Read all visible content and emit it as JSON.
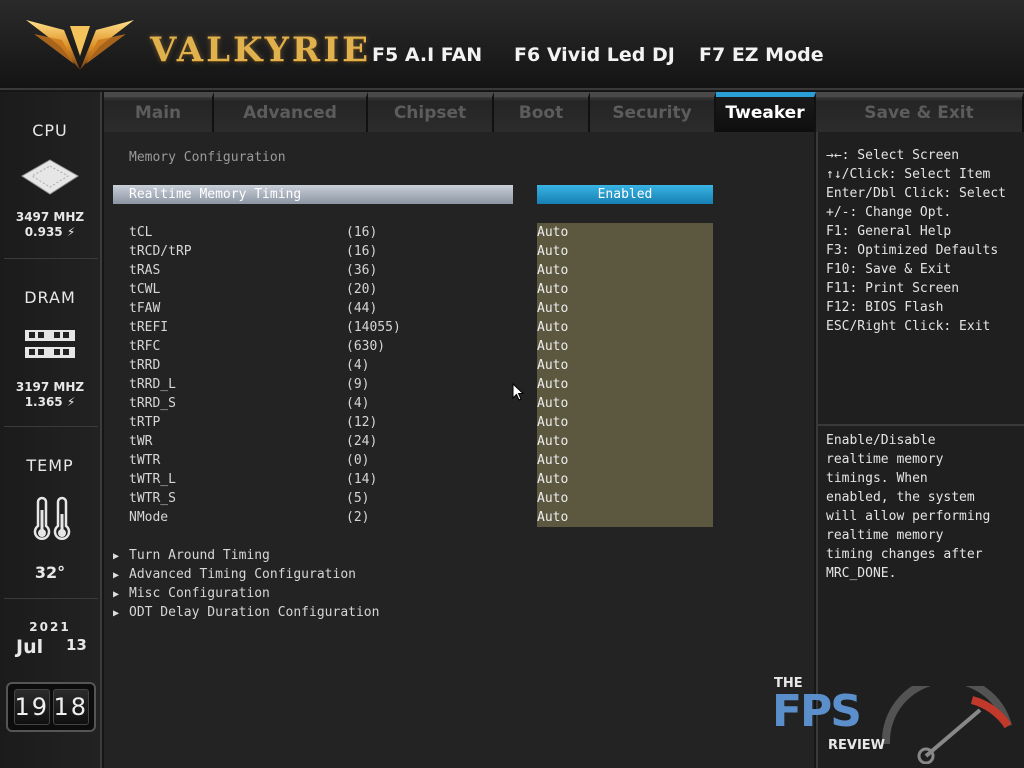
{
  "header": {
    "brand": "VALKYRIE",
    "hotkeys": [
      {
        "label": "F5 A.I FAN"
      },
      {
        "label": "F6 Vivid Led DJ"
      },
      {
        "label": "F7 EZ Mode"
      }
    ]
  },
  "sidebar": {
    "cpu": {
      "label": "CPU",
      "freq": "3497 MHZ",
      "volt": "0.935"
    },
    "dram": {
      "label": "DRAM",
      "freq": "3197 MHZ",
      "volt": "1.365"
    },
    "temp": {
      "label": "TEMP",
      "value": "32°"
    },
    "date": {
      "year": "2021",
      "month": "Jul",
      "day": "13"
    },
    "time": {
      "hour": "19",
      "minute": "18"
    }
  },
  "tabs": [
    {
      "label": "Main"
    },
    {
      "label": "Advanced"
    },
    {
      "label": "Chipset"
    },
    {
      "label": "Boot"
    },
    {
      "label": "Security"
    },
    {
      "label": "Tweaker",
      "active": true
    },
    {
      "label": "Save & Exit"
    }
  ],
  "main": {
    "title": "Memory Configuration",
    "realtime": {
      "label": "Realtime Memory Timing",
      "value": "Enabled"
    },
    "timings": [
      {
        "name": "tCL",
        "current": "(16)",
        "setting": "Auto"
      },
      {
        "name": "tRCD/tRP",
        "current": "(16)",
        "setting": "Auto"
      },
      {
        "name": "tRAS",
        "current": "(36)",
        "setting": "Auto"
      },
      {
        "name": "tCWL",
        "current": "(20)",
        "setting": "Auto"
      },
      {
        "name": "tFAW",
        "current": "(44)",
        "setting": "Auto"
      },
      {
        "name": "tREFI",
        "current": "(14055)",
        "setting": "Auto"
      },
      {
        "name": "tRFC",
        "current": "(630)",
        "setting": "Auto"
      },
      {
        "name": "tRRD",
        "current": "(4)",
        "setting": "Auto"
      },
      {
        "name": "tRRD_L",
        "current": "(9)",
        "setting": "Auto"
      },
      {
        "name": "tRRD_S",
        "current": "(4)",
        "setting": "Auto"
      },
      {
        "name": "tRTP",
        "current": "(12)",
        "setting": "Auto"
      },
      {
        "name": "tWR",
        "current": "(24)",
        "setting": "Auto"
      },
      {
        "name": "tWTR",
        "current": "(0)",
        "setting": "Auto"
      },
      {
        "name": "tWTR_L",
        "current": "(14)",
        "setting": "Auto"
      },
      {
        "name": "tWTR_S",
        "current": "(5)",
        "setting": "Auto"
      },
      {
        "name": "NMode",
        "current": "(2)",
        "setting": "Auto"
      }
    ],
    "submenus": [
      {
        "label": "Turn Around Timing"
      },
      {
        "label": "Advanced Timing Configuration"
      },
      {
        "label": "Misc Configuration"
      },
      {
        "label": "ODT Delay Duration Configuration"
      }
    ]
  },
  "help": {
    "keys": [
      "→←: Select Screen",
      "↑↓/Click: Select Item",
      "Enter/Dbl Click: Select",
      "+/-: Change Opt.",
      "F1: General Help",
      "F3: Optimized Defaults",
      "F10: Save & Exit",
      "F11: Print Screen",
      "F12: BIOS Flash",
      "ESC/Right Click: Exit"
    ],
    "description": [
      "Enable/Disable",
      "realtime memory",
      "timings. When",
      "enabled, the system",
      "will allow performing",
      "realtime memory",
      "timing changes after",
      "MRC_DONE."
    ]
  },
  "watermark": {
    "the": "THE",
    "fps": "FPS",
    "review": "REVIEW"
  },
  "colors": {
    "accent": "#2a9fd6",
    "gold": "#e1b14e",
    "auto_bg": "#5b583f"
  }
}
